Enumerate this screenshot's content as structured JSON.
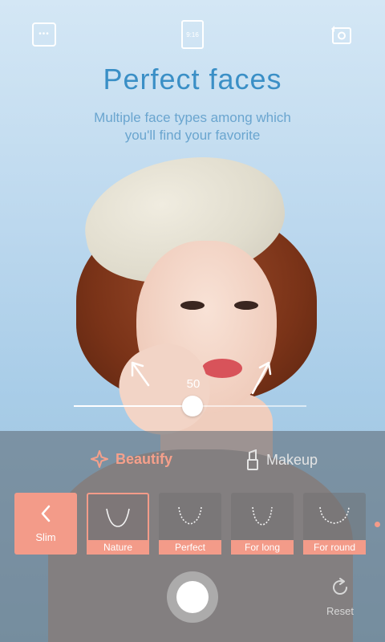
{
  "header": {
    "menu_icon": "menu-dots-icon",
    "ratio_icon": "aspect-ratio-icon",
    "ratio_text": "9:16",
    "switch_icon": "switch-camera-icon"
  },
  "promo": {
    "title": "Perfect faces",
    "subtitle_line1": "Multiple face types among which",
    "subtitle_line2": "you'll find your favorite"
  },
  "slider": {
    "value": "50",
    "level_percent": 50
  },
  "tabs": [
    {
      "label": "Beautify",
      "icon": "sparkle-icon",
      "active": true
    },
    {
      "label": "Makeup",
      "icon": "lipstick-icon",
      "active": false
    }
  ],
  "category": {
    "label": "Slim",
    "icon": "chevron-left-icon"
  },
  "options": [
    {
      "label": "Nature",
      "selected": true
    },
    {
      "label": "Perfect",
      "selected": false
    },
    {
      "label": "For long",
      "selected": false
    },
    {
      "label": "For round",
      "selected": false
    }
  ],
  "controls": {
    "shutter_icon": "shutter-icon",
    "reset_label": "Reset",
    "reset_icon": "reset-icon"
  },
  "colors": {
    "accent": "#f39b89",
    "title": "#3a8fc6"
  }
}
